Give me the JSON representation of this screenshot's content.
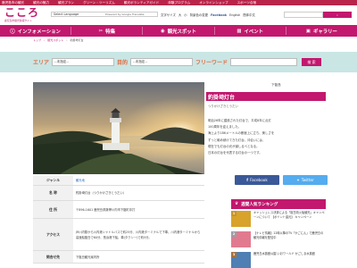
{
  "topbar": [
    "鹿児島市の観光",
    "観光の魅力",
    "観光プラン",
    "グリーン・ツーリズム",
    "観光ボランティアガイド",
    "体験プログラム",
    "オンラインショップ",
    "スポーツ合宿"
  ],
  "logo": {
    "mark": "こころ",
    "sub": "鹿児島市観光情報サイト"
  },
  "header": {
    "language_select": "Select Language",
    "powered": "Powered by Google Translate",
    "links": [
      "文字サイズ",
      "大",
      "小",
      "背景色の変更"
    ],
    "facebook": "Facebook",
    "english": "English",
    "chinese": "簡体中文"
  },
  "nav": [
    {
      "icon": "info-icon",
      "glyph": "ⓘ",
      "label": "インフォメーション"
    },
    {
      "icon": "food-icon",
      "glyph": "✂",
      "label": "特集"
    },
    {
      "icon": "camera-icon",
      "glyph": "◉",
      "label": "観光スポット"
    },
    {
      "icon": "calendar-icon",
      "glyph": "▦",
      "label": "イベント"
    },
    {
      "icon": "gallery-icon",
      "glyph": "▣",
      "label": "ギャラリー"
    }
  ],
  "breadcrumb": [
    "トップ",
    "観光スポット",
    "釣掛埼灯台"
  ],
  "search": {
    "area_label": "エリア",
    "area_value": "--未指定--",
    "genre_label": "目的",
    "genre_value": "--未指定--",
    "free_label": "フリーワード",
    "button": "検 索"
  },
  "spot": {
    "category": "下甑島",
    "title": "釣掛埼灯台",
    "ruby": "つりかけざきとうだい",
    "description": [
      "明治26年に建設された灯台で、平成8年に点灯",
      "100周年を迎えました。",
      "海上より186メートルの断崖上に立ち、美しさを",
      "ずっと眺め続けてきた灯台。沖合いには、",
      "現在でも灯台の光が道しるべとなる。",
      "日本の灯台を代表する灯台の一つです。"
    ]
  },
  "details": [
    {
      "label": "ジャンル",
      "value": "観光地",
      "link": true
    },
    {
      "label": "名 称",
      "value": "釣掛埼灯台（つりかけざきとうだい）",
      "link": false
    },
    {
      "label": "住 所",
      "value": "〒896-1601 鹿児島県薩摩川内市下甑町手打",
      "link": false
    },
    {
      "label": "アクセス",
      "value": "JR川内駅から川内港シャトルバスで約25分、川内港ターミナルで下車。川内港ターミナルから高速船甑島で60分、長浜港下船。車(タクシー)で約5分。",
      "link": false
    },
    {
      "label": "問合せ先",
      "value": "下甑島観光案内所",
      "link": false
    }
  ],
  "share": {
    "facebook": "Facebook",
    "twitter": "Twitter"
  },
  "ranking": {
    "title": "週間人気ランキング",
    "items": [
      {
        "rank": "1",
        "text": "キャッシュレス決済による「桜島噴火後観光」キャンペーンについて 【ポイント還元】 キャンペーン"
      },
      {
        "rank": "2",
        "text": "【ナレビ情報】12時以降のTV「かごにん」で鹿児島の観光情報を配信中"
      },
      {
        "rank": "3",
        "text": "鹿児島水族館公園 いおワールド かごしま水族館"
      }
    ]
  },
  "colors": {
    "brand": "#c2186e",
    "topbar": "#b8244a",
    "search_band": "#c9e6e4",
    "search_label": "#e46a3f"
  }
}
